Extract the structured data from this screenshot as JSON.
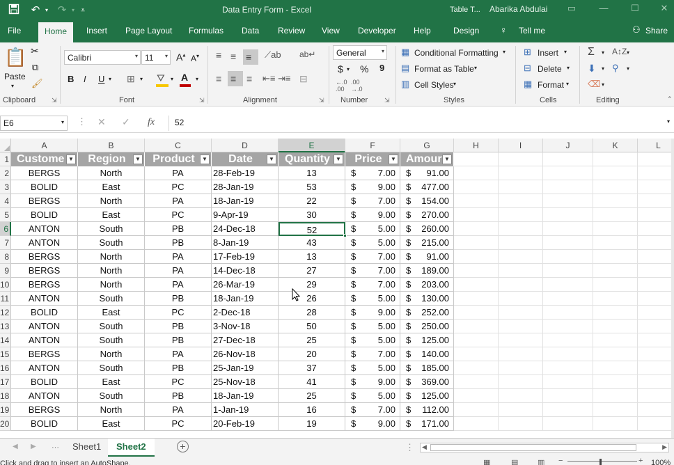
{
  "titlebar": {
    "document_title": "Data Entry Form  -  Excel",
    "context_label": "Table T...",
    "user_name": "Abarika Abdulai",
    "icons": [
      "save-icon",
      "undo-icon",
      "redo-icon",
      "customize-icon"
    ]
  },
  "tabs": [
    "File",
    "Home",
    "Insert",
    "Page Layout",
    "Formulas",
    "Data",
    "Review",
    "View",
    "Developer",
    "Help",
    "Design"
  ],
  "active_tab": "Home",
  "tell_me": "Tell me",
  "share": "Share",
  "ribbon": {
    "clipboard": {
      "label": "Clipboard",
      "paste": "Paste"
    },
    "font": {
      "label": "Font",
      "font_name": "Calibri",
      "font_size": "11",
      "bold": "B",
      "italic": "I",
      "underline": "U",
      "grow": "A",
      "shrink": "A",
      "font_color_glyph": "A"
    },
    "alignment": {
      "label": "Alignment"
    },
    "number": {
      "label": "Number",
      "format": "General",
      "currency": "$",
      "percent": "%",
      "comma": "9"
    },
    "styles": {
      "label": "Styles",
      "conditional": "Conditional Formatting",
      "format_table": "Format as Table",
      "cell_styles": "Cell Styles"
    },
    "cells": {
      "label": "Cells",
      "insert": "Insert",
      "delete": "Delete",
      "format": "Format"
    },
    "editing": {
      "label": "Editing"
    }
  },
  "formula_bar": {
    "name_box": "E6",
    "formula": "52",
    "fx": "fx"
  },
  "columns": [
    "A",
    "B",
    "C",
    "D",
    "E",
    "F",
    "G",
    "H",
    "I",
    "J",
    "K",
    "L"
  ],
  "selected_column": "E",
  "selected_row": "6",
  "table_headers": [
    "Custome",
    "Region",
    "Product",
    "Date",
    "Quantity",
    "Price",
    "Amour"
  ],
  "rows": [
    [
      "2",
      "BERGS",
      "North",
      "PA",
      "28-Feb-19",
      "13",
      "7.00",
      "91.00"
    ],
    [
      "3",
      "BOLID",
      "East",
      "PC",
      "28-Jan-19",
      "53",
      "9.00",
      "477.00"
    ],
    [
      "4",
      "BERGS",
      "North",
      "PA",
      "18-Jan-19",
      "22",
      "7.00",
      "154.00"
    ],
    [
      "5",
      "BOLID",
      "East",
      "PC",
      "9-Apr-19",
      "30",
      "9.00",
      "270.00"
    ],
    [
      "6",
      "ANTON",
      "South",
      "PB",
      "24-Dec-18",
      "52",
      "5.00",
      "260.00"
    ],
    [
      "7",
      "ANTON",
      "South",
      "PB",
      "8-Jan-19",
      "43",
      "5.00",
      "215.00"
    ],
    [
      "8",
      "BERGS",
      "North",
      "PA",
      "17-Feb-19",
      "13",
      "7.00",
      "91.00"
    ],
    [
      "9",
      "BERGS",
      "North",
      "PA",
      "14-Dec-18",
      "27",
      "7.00",
      "189.00"
    ],
    [
      "10",
      "BERGS",
      "North",
      "PA",
      "26-Mar-19",
      "29",
      "7.00",
      "203.00"
    ],
    [
      "11",
      "ANTON",
      "South",
      "PB",
      "18-Jan-19",
      "26",
      "5.00",
      "130.00"
    ],
    [
      "12",
      "BOLID",
      "East",
      "PC",
      "2-Dec-18",
      "28",
      "9.00",
      "252.00"
    ],
    [
      "13",
      "ANTON",
      "South",
      "PB",
      "3-Nov-18",
      "50",
      "5.00",
      "250.00"
    ],
    [
      "14",
      "ANTON",
      "South",
      "PB",
      "27-Dec-18",
      "25",
      "5.00",
      "125.00"
    ],
    [
      "15",
      "BERGS",
      "North",
      "PA",
      "26-Nov-18",
      "20",
      "7.00",
      "140.00"
    ],
    [
      "16",
      "ANTON",
      "South",
      "PB",
      "25-Jan-19",
      "37",
      "5.00",
      "185.00"
    ],
    [
      "17",
      "BOLID",
      "East",
      "PC",
      "25-Nov-18",
      "41",
      "9.00",
      "369.00"
    ],
    [
      "18",
      "ANTON",
      "South",
      "PB",
      "18-Jan-19",
      "25",
      "5.00",
      "125.00"
    ],
    [
      "19",
      "BERGS",
      "North",
      "PA",
      "1-Jan-19",
      "16",
      "7.00",
      "112.00"
    ],
    [
      "20",
      "BOLID",
      "East",
      "PC",
      "20-Feb-19",
      "19",
      "9.00",
      "171.00"
    ]
  ],
  "currency_symbol": "$",
  "sheets": [
    "Sheet1",
    "Sheet2"
  ],
  "active_sheet": "Sheet2",
  "status": {
    "message": "Click and drag to insert an AutoShape.",
    "zoom": "100%"
  },
  "colors": {
    "accent": "#217346",
    "table_header": "#a5a5a5"
  }
}
